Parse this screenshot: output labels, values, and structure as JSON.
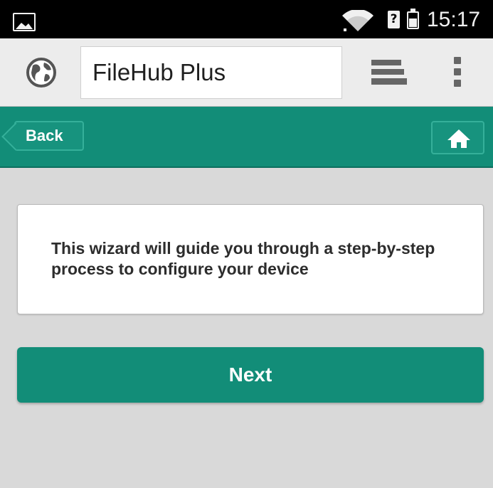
{
  "status_bar": {
    "time": "15:17",
    "sim_indicator": "?",
    "icons": [
      "image-notification-icon",
      "wifi-icon",
      "sim-icon",
      "battery-icon"
    ]
  },
  "browser": {
    "url_text": "FileHub Plus",
    "icons": [
      "globe-icon",
      "tabs-icon",
      "overflow-menu-icon"
    ]
  },
  "header": {
    "back_label": "Back",
    "home_icon": "home-icon",
    "accent_color": "#128d78"
  },
  "main": {
    "info_text": "This wizard will guide you through a step-by-step process to configure your device",
    "next_label": "Next"
  }
}
